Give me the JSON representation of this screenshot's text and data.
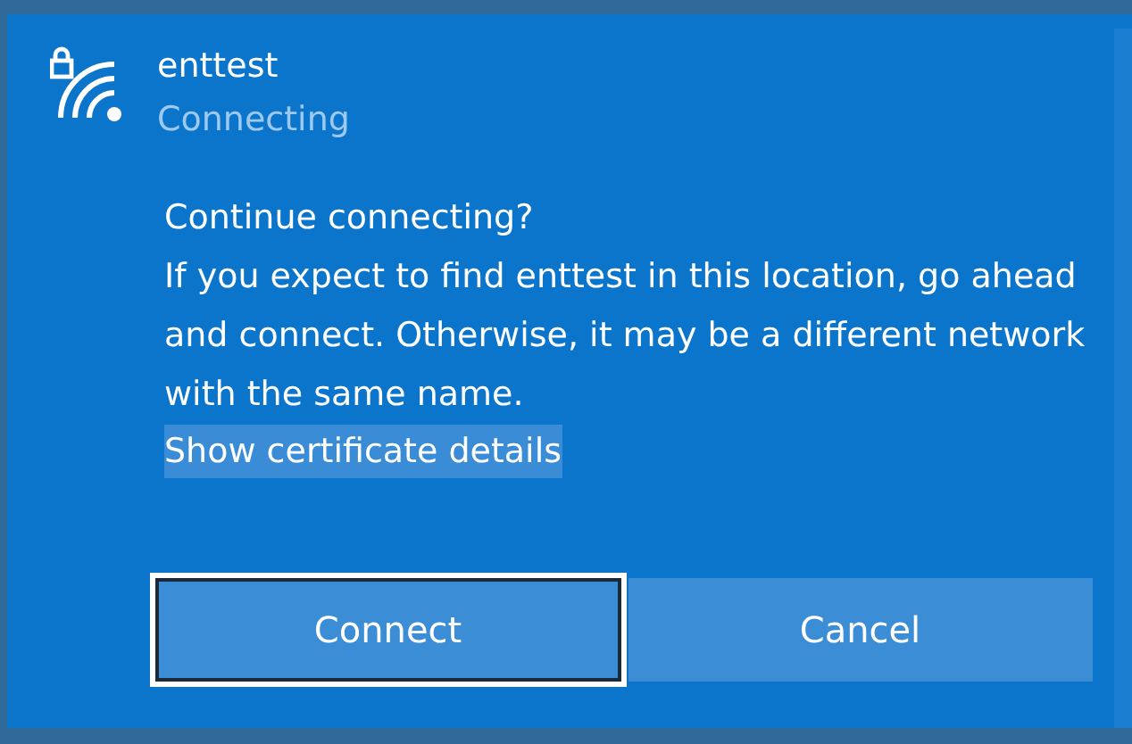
{
  "network": {
    "name": "enttest",
    "status": "Connecting",
    "secured": true
  },
  "prompt": {
    "question": "Continue connecting?",
    "message": "If you expect to find enttest in this location, go ahead and connect. Otherwise, it may be a different network with the same name."
  },
  "link": {
    "label": "Show certificate details",
    "highlighted": true
  },
  "buttons": [
    {
      "label": "Connect",
      "focused": true
    },
    {
      "label": "Cancel",
      "focused": false
    }
  ]
}
